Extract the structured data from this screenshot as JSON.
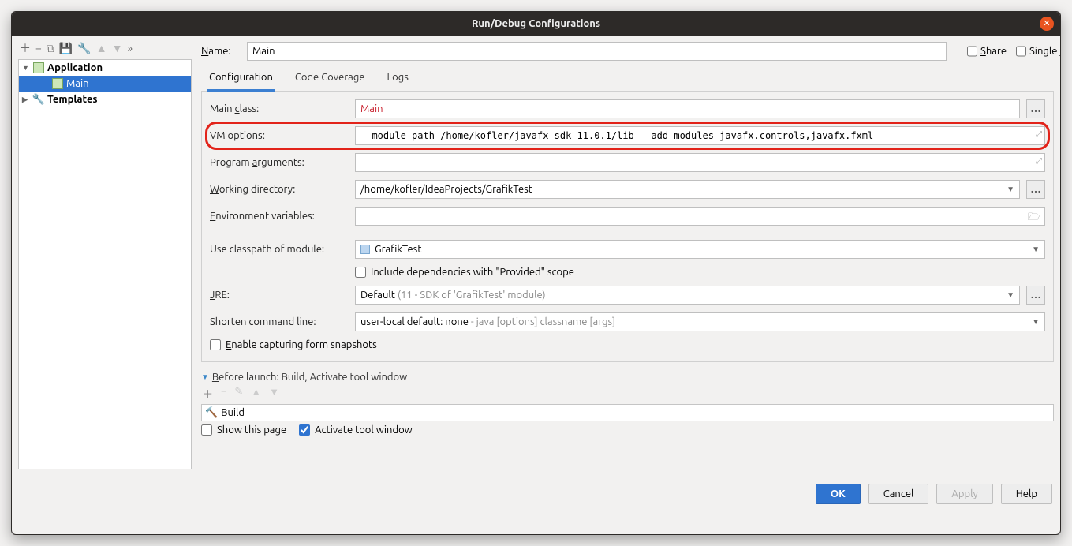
{
  "window_title": "Run/Debug Configurations",
  "tree": {
    "application_label": "Application",
    "main_label": "Main",
    "templates_label": "Templates"
  },
  "name_label": "Name:",
  "name_value": "Main",
  "share_label": "Share",
  "single_instance_label": "Single instance only",
  "tabs": {
    "configuration": "Configuration",
    "code_coverage": "Code Coverage",
    "logs": "Logs"
  },
  "form": {
    "main_class_label": "Main class:",
    "main_class_value": "Main",
    "vm_options_label": "VM options:",
    "vm_options_value": "--module-path /home/kofler/javafx-sdk-11.0.1/lib --add-modules javafx.controls,javafx.fxml",
    "program_args_label": "Program arguments:",
    "program_args_value": "",
    "working_dir_label": "Working directory:",
    "working_dir_value": "/home/kofler/IdeaProjects/GrafikTest",
    "env_vars_label": "Environment variables:",
    "env_vars_value": "",
    "classpath_label": "Use classpath of module:",
    "classpath_value": "GrafikTest",
    "include_provided_label": "Include dependencies with \"Provided\" scope",
    "jre_label": "JRE:",
    "jre_value_a": "Default",
    "jre_value_b": " (11 - SDK of 'GrafikTest' module)",
    "shorten_label": "Shorten command line:",
    "shorten_value_a": "user-local default: none",
    "shorten_value_b": " - java [options] classname [args]",
    "enable_capture_label": "Enable capturing form snapshots"
  },
  "before_launch": {
    "header": "Before launch: Build, Activate tool window",
    "build": "Build",
    "show_page": "Show this page",
    "activate_tool": "Activate tool window"
  },
  "buttons": {
    "ok": "OK",
    "cancel": "Cancel",
    "apply": "Apply",
    "help": "Help"
  }
}
